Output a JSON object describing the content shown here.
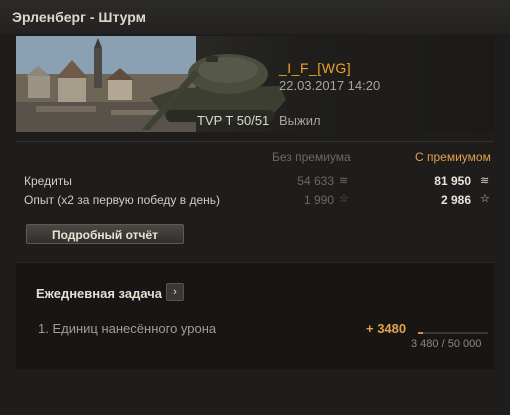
{
  "window": {
    "title": "Эрленберг - Штурм"
  },
  "player": {
    "nickname": "_I_F_[WG]",
    "datetime": "22.03.2017 14:20",
    "tank": "TVP T 50/51",
    "status": "Выжил"
  },
  "columns": {
    "free": "Без премиума",
    "premium": "С премиумом"
  },
  "rows": [
    {
      "label": "Кредиты",
      "free": "54 633",
      "premium": "81 950",
      "icon": "credits-icon"
    },
    {
      "label": "Опыт  (x2 за первую победу в день)",
      "free": "1 990",
      "premium": "2 986",
      "icon": "experience-star-icon"
    }
  ],
  "details_button": "Подробный отчёт",
  "daily_task": {
    "title": "Ежедневная задача",
    "item": "1. Единиц нанесённого урона",
    "reward": "+ 3480",
    "progress_text": "3 480 / 50 000",
    "progress_fraction": 0.0696
  },
  "colors": {
    "accent": "#e3a14a",
    "nickname": "#f0a22a"
  }
}
